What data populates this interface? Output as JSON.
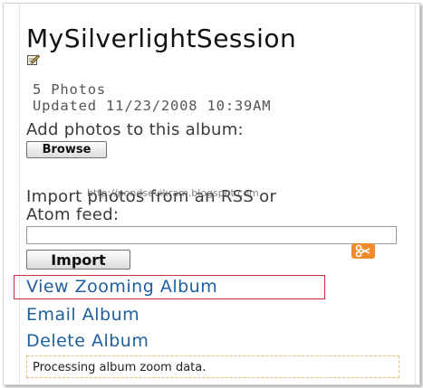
{
  "album": {
    "title": "MySilverlightSession",
    "photo_count": "5 Photos",
    "updated": "Updated 11/23/2008 10:39AM"
  },
  "add_photos": {
    "label": "Add photos to this album:",
    "browse_label": "Browse"
  },
  "import_feed": {
    "label_line1": "Import photos from an RSS or",
    "label_line2": "Atom feed:",
    "url_value": "",
    "import_label": "Import"
  },
  "links": {
    "view_zooming": "View Zooming Album",
    "email": "Email Album",
    "delete": "Delete Album"
  },
  "status": {
    "message": "Processing album zoom data."
  },
  "watermark": "http://pondsevikram.blogspot.com",
  "colors": {
    "link": "#1f5f9e",
    "highlight_border": "#c8343c",
    "status_border": "#e2c06a",
    "scissor_icon": "#f08a2a"
  }
}
